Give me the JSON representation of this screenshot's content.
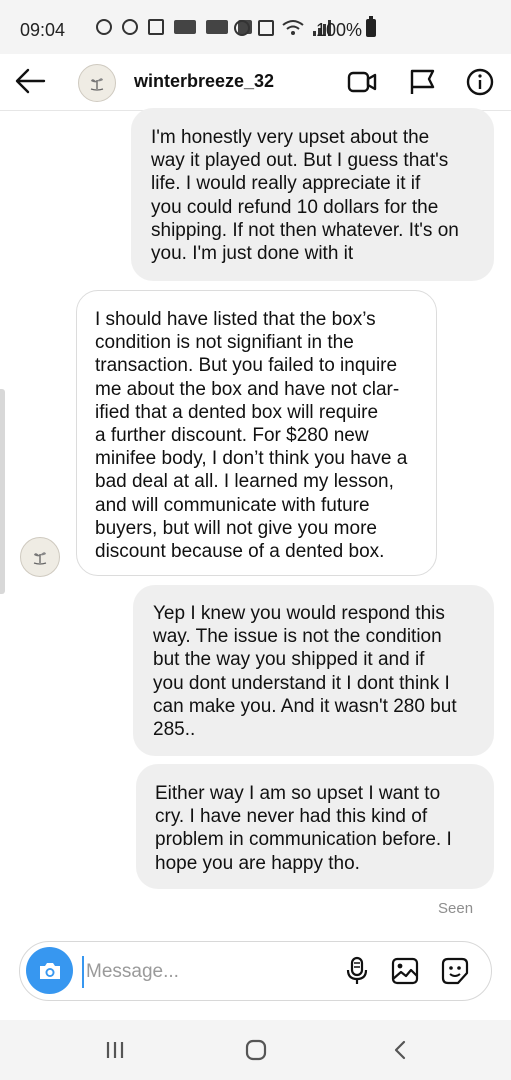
{
  "status_bar": {
    "time": "09:04",
    "battery": "100%"
  },
  "header": {
    "username": "winterbreeze_32",
    "icons": [
      "back-arrow-icon",
      "video-call-icon",
      "flag-icon",
      "info-icon"
    ]
  },
  "messages": [
    {
      "direction": "outgoing",
      "text": "I'm honestly very upset about the\nway it played out. But I guess that's\nlife. I would really appreciate it if\nyou could refund 10 dollars for the\nshipping. If not then whatever. It's on\nyou. I'm just done with it"
    },
    {
      "direction": "incoming",
      "text": "I should have listed that the box’s\ncondition is not signifiant in the\ntransaction. But you failed to inquire\nme about the box and have not clar-\nified that a dented box will require\na further discount. For $280 new\nminifee body, I don’t think you have a\nbad deal at all. I learned my lesson,\nand will communicate with future\nbuyers, but will not give you more\ndiscount because of a dented box."
    },
    {
      "direction": "outgoing",
      "text": "Yep I knew you would respond this\nway. The issue is not the condition\nbut the way you shipped it and if\nyou dont understand it I dont think I\ncan make you. And it wasn't 280 but\n285.."
    },
    {
      "direction": "outgoing",
      "text": "Either way I am so upset I want to\ncry. I have never had this kind of\nproblem in communication before. I\nhope you are happy tho."
    }
  ],
  "seen_label": "Seen",
  "composer": {
    "placeholder": "Message...",
    "value": ""
  },
  "colors": {
    "accent": "#3797f0",
    "outgoing_bubble": "#efefef",
    "incoming_border": "#dcdcdc"
  }
}
